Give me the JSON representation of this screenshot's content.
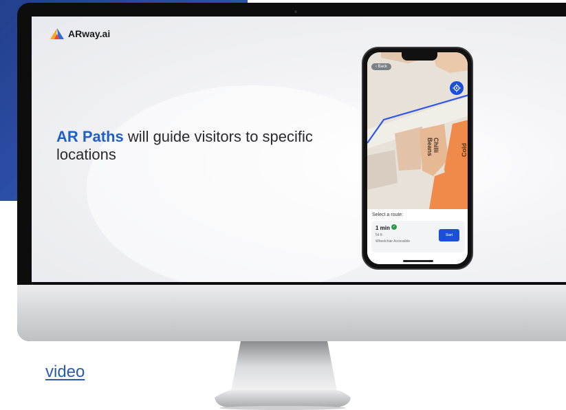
{
  "backdrop": {
    "partial_text": ""
  },
  "logo": {
    "text": "ARway.ai",
    "icon": "arway-logo"
  },
  "headline": {
    "accent": "AR Paths",
    "rest": " will guide visitors to specific locations"
  },
  "phone": {
    "back_label": "Back",
    "map_labels": {
      "store_1": "Chilli Beans",
      "store_2": "Cold"
    },
    "locate_icon": "crosshair-icon",
    "sheet": {
      "title": "Select a route:",
      "route": {
        "time": "1 min",
        "distance": "54 ft",
        "access": "Wheelchair Accessible",
        "start_label": "Start"
      }
    }
  },
  "link": {
    "text": "video"
  },
  "colors": {
    "accent": "#1f5fc9",
    "backdrop": "#2b4ea6",
    "route_line": "#2f57e6",
    "store_orange": "#f08a4b",
    "start_button": "#1c4fd7",
    "link": "#2b5ca8"
  }
}
